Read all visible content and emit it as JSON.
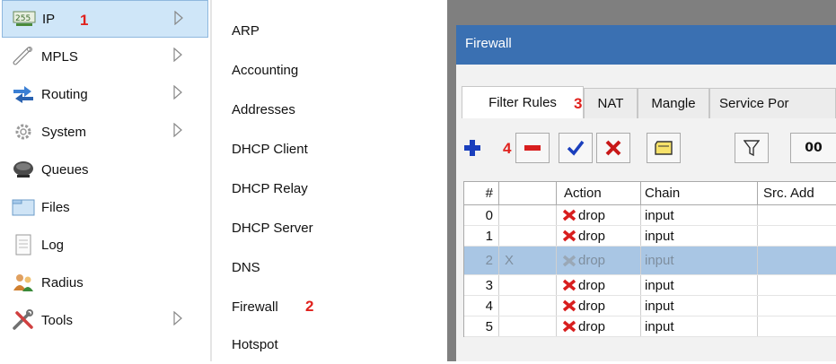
{
  "main_menu": {
    "items": [
      {
        "label": "IP",
        "icon": "ip-255-icon",
        "has_submenu": true,
        "selected": true
      },
      {
        "label": "MPLS",
        "icon": "mpls-icon",
        "has_submenu": true
      },
      {
        "label": "Routing",
        "icon": "routing-icon",
        "has_submenu": true
      },
      {
        "label": "System",
        "icon": "system-gear-icon",
        "has_submenu": true
      },
      {
        "label": "Queues",
        "icon": "queues-icon",
        "has_submenu": false
      },
      {
        "label": "Files",
        "icon": "folder-icon",
        "has_submenu": false
      },
      {
        "label": "Log",
        "icon": "log-icon",
        "has_submenu": false
      },
      {
        "label": "Radius",
        "icon": "radius-users-icon",
        "has_submenu": false
      },
      {
        "label": "Tools",
        "icon": "tools-icon",
        "has_submenu": true
      }
    ]
  },
  "submenu": {
    "items": [
      "ARP",
      "Accounting",
      "Addresses",
      "DHCP Client",
      "DHCP Relay",
      "DHCP Server",
      "DNS",
      "Firewall",
      "Hotspot"
    ]
  },
  "annotations": {
    "step1": "1",
    "step2": "2",
    "step3": "3",
    "step4": "4"
  },
  "firewall": {
    "title": "Firewall",
    "tabs": [
      "Filter Rules",
      "NAT",
      "Mangle",
      "Service Por"
    ],
    "active_tab": "Filter Rules",
    "toolbar": {
      "add": "add-icon",
      "remove": "remove-icon",
      "enable": "enable-check-icon",
      "disable": "disable-x-icon",
      "comment": "comment-icon",
      "filter": "filter-icon",
      "reset_counters": "00"
    },
    "table": {
      "columns": [
        "#",
        "",
        "Action",
        "Chain",
        "Src. Add"
      ],
      "rows": [
        {
          "num": "0",
          "flag": "",
          "action": "drop",
          "chain": "input"
        },
        {
          "num": "1",
          "flag": "",
          "action": "drop",
          "chain": "input"
        },
        {
          "num": "2",
          "flag": "X",
          "action": "drop",
          "chain": "input",
          "disabled": true
        },
        {
          "num": "3",
          "flag": "",
          "action": "drop",
          "chain": "input"
        },
        {
          "num": "4",
          "flag": "",
          "action": "drop",
          "chain": "input"
        },
        {
          "num": "5",
          "flag": "",
          "action": "drop",
          "chain": "input"
        }
      ]
    }
  },
  "colors": {
    "titlebar": "#3a70b2",
    "selected_row": "#a9c6e4",
    "annotation_red": "#e0211d",
    "add_blue": "#1a3fbd",
    "remove_red": "#d81e1e"
  }
}
